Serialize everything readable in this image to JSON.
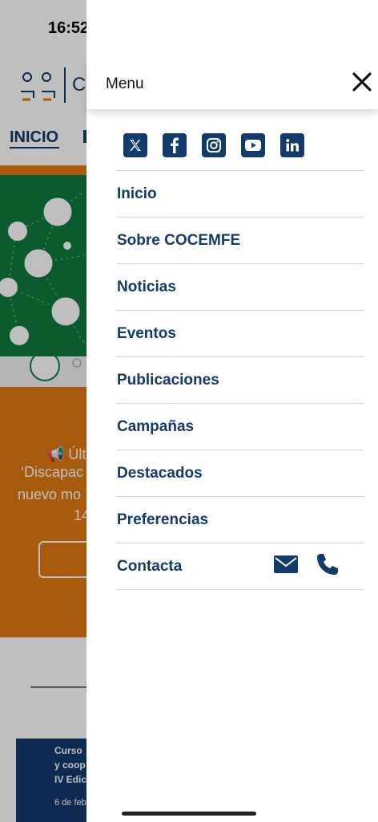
{
  "status_bar": {
    "time": "16:52"
  },
  "background_page": {
    "logo_letter": "C",
    "nav_active": "INICIO",
    "banner_lines": [
      "📢 Últ",
      "‘Discapac",
      "nuevo mo",
      "14"
    ],
    "card_lines": [
      "Curso",
      "y coop",
      "IV Edic",
      "6 de febr"
    ]
  },
  "drawer": {
    "title": "Menu",
    "social": [
      {
        "name": "x-icon"
      },
      {
        "name": "facebook-icon"
      },
      {
        "name": "instagram-icon"
      },
      {
        "name": "youtube-icon"
      },
      {
        "name": "linkedin-icon"
      }
    ],
    "items": [
      {
        "label": "Inicio"
      },
      {
        "label": "Sobre COCEMFE"
      },
      {
        "label": "Noticias"
      },
      {
        "label": "Eventos"
      },
      {
        "label": "Publicaciones"
      },
      {
        "label": "Campañas"
      },
      {
        "label": "Destacados"
      },
      {
        "label": "Preferencias"
      },
      {
        "label": "Contacta"
      }
    ]
  },
  "colors": {
    "brand_blue": "#123a6b",
    "orange": "#e07a10",
    "green": "#0f7a3e"
  }
}
